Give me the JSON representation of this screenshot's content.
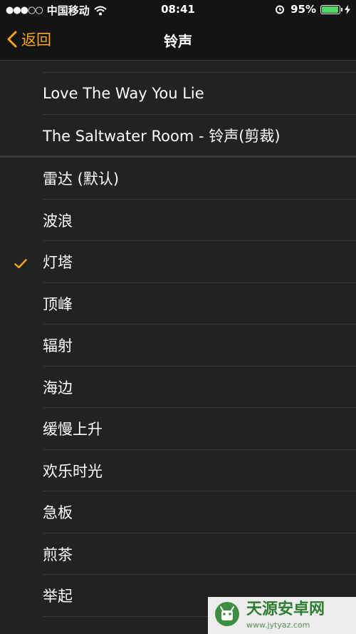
{
  "status_bar": {
    "signal": "●●●○○",
    "carrier": "中国移动",
    "time": "08:41",
    "battery_text": "95%",
    "battery_level": 0.95
  },
  "nav": {
    "back_label": "返回",
    "title": "铃声"
  },
  "custom_tones": [
    "Love The Way You Lie",
    "The Saltwater Room - 铃声(剪裁)"
  ],
  "system_tones": [
    "雷达 (默认)",
    "波浪",
    "灯塔",
    "顶峰",
    "辐射",
    "海边",
    "缓慢上升",
    "欢乐时光",
    "急板",
    "煎茶",
    "举起"
  ],
  "selected_tone": "灯塔",
  "watermark": {
    "title": "天源安卓网",
    "url": "www.jytyaz.com"
  },
  "colors": {
    "accent": "#f7a51c",
    "background": "#222222",
    "bar": "#141414",
    "battery": "#4cd964"
  }
}
